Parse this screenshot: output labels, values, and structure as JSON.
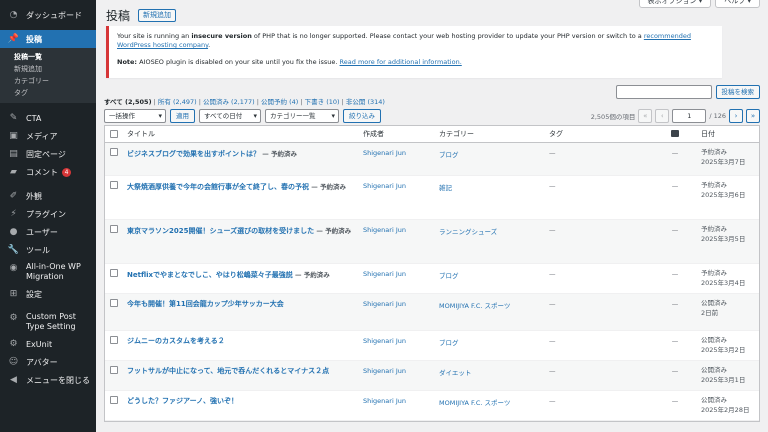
{
  "sidebar": {
    "dashboard": "ダッシュボード",
    "posts": "投稿",
    "sub": [
      "投稿一覧",
      "新規追加",
      "カテゴリー",
      "タグ"
    ],
    "items": [
      {
        "label": "CTA",
        "icon": "pin-icon"
      },
      {
        "label": "メディア",
        "icon": "media-icon"
      },
      {
        "label": "固定ページ",
        "icon": "page-icon"
      },
      {
        "label": "コメント",
        "icon": "comment-icon",
        "badge": "4"
      },
      {
        "label": "外観",
        "icon": "appearance-icon"
      },
      {
        "label": "プラグイン",
        "icon": "plugin-icon"
      },
      {
        "label": "ユーザー",
        "icon": "user-icon"
      },
      {
        "label": "ツール",
        "icon": "wrench-icon"
      },
      {
        "label": "All-in-One WP Migration",
        "icon": "migration-icon"
      },
      {
        "label": "設定",
        "icon": "settings-icon"
      },
      {
        "label": "Custom Post Type Setting",
        "icon": "gear-icon"
      },
      {
        "label": "ExUnit",
        "icon": "gear-icon"
      },
      {
        "label": "アバター",
        "icon": "avatar-icon"
      },
      {
        "label": "メニューを閉じる",
        "icon": "collapse-icon"
      }
    ]
  },
  "header": {
    "title": "投稿",
    "add_new": "新規追加",
    "screen_options": "表示オプション ▾",
    "help": "ヘルプ ▾"
  },
  "notices": {
    "php_pre": "Your site is running an ",
    "php_bold": "insecure version",
    "php_mid": " of PHP that is no longer supported. Please contact your web hosting provider to update your PHP version or switch to a ",
    "php_link": "recommended WordPress hosting company",
    "php_end": ".",
    "aioseo_bold": "Note:",
    "aioseo_text": " AIOSEO plugin is disabled on your site until you fix the issue. ",
    "aioseo_link": "Read more for additional information."
  },
  "views": {
    "all": "すべて (2,505)",
    "mine": "所有 (2,497)",
    "published": "公開済み (2,177)",
    "scheduled": "公開予約 (4)",
    "drafts": "下書き (10)",
    "private": "非公開 (314)"
  },
  "search": {
    "button": "投稿を検索"
  },
  "tablenav": {
    "bulk_action": "一括操作",
    "apply": "適用",
    "all_dates": "すべての日付",
    "category_list": "カテゴリー一覧",
    "filter": "絞り込み",
    "items_count": "2,505個の項目",
    "first": "«",
    "prev": "‹",
    "current_page": "1",
    "total_pages": "/ 126",
    "next": "›",
    "last": "»"
  },
  "columns": {
    "title": "タイトル",
    "author": "作成者",
    "category": "カテゴリー",
    "tags": "タグ",
    "date": "日付"
  },
  "rows": [
    {
      "title": "ビジネスブログで効果を出すポイントは？",
      "state": " — 予約済み",
      "author": "Shigenari Jun",
      "category": "ブログ",
      "tags": "—",
      "comments": "—",
      "date_status": "予約済み",
      "date": "2025年3月7日"
    },
    {
      "title": "大祭焼酒厚供養で今年の会館行事が全て終了し、春の予祝",
      "state": " — 予約済み",
      "author": "Shigenari Jun",
      "category": "雑記",
      "tags": "—",
      "comments": "—",
      "date_status": "予約済み",
      "date": "2025年3月6日"
    },
    {
      "title": "東京マラソン2025開催！シューズ選びの取材を受けました",
      "state": " — 予約済み",
      "author": "Shigenari Jun",
      "category": "ランニングシューズ",
      "tags": "—",
      "comments": "—",
      "date_status": "予約済み",
      "date": "2025年3月5日"
    },
    {
      "title": "Netflixでやまとなでしこ、やはり松嶋菜々子最強説",
      "state": " — 予約済み",
      "author": "Shigenari Jun",
      "category": "ブログ",
      "tags": "—",
      "comments": "—",
      "date_status": "予約済み",
      "date": "2025年3月4日"
    },
    {
      "title": "今年も開催！第11回会龍カップ少年サッカー大会",
      "state": "",
      "author": "Shigenari Jun",
      "category": "MOMIJIYA F.C. スポーツ",
      "tags": "—",
      "comments": "—",
      "date_status": "公開済み",
      "date": "2日前"
    },
    {
      "title": "ジムニーのカスタムを考える２",
      "state": "",
      "author": "Shigenari Jun",
      "category": "ブログ",
      "tags": "—",
      "comments": "—",
      "date_status": "公開済み",
      "date": "2025年3月2日"
    },
    {
      "title": "フットサルが中止になって、地元で呑んだくれるとマイナス２点",
      "state": "",
      "author": "Shigenari Jun",
      "category": "ダイエット",
      "tags": "—",
      "comments": "—",
      "date_status": "公開済み",
      "date": "2025年3月1日"
    },
    {
      "title": "どうした？ファジアーノ、強いぞ！",
      "state": "",
      "author": "Shigenari Jun",
      "category": "MOMIJIYA F.C. スポーツ",
      "tags": "—",
      "comments": "—",
      "date_status": "公開済み",
      "date": "2025年2月28日"
    }
  ]
}
